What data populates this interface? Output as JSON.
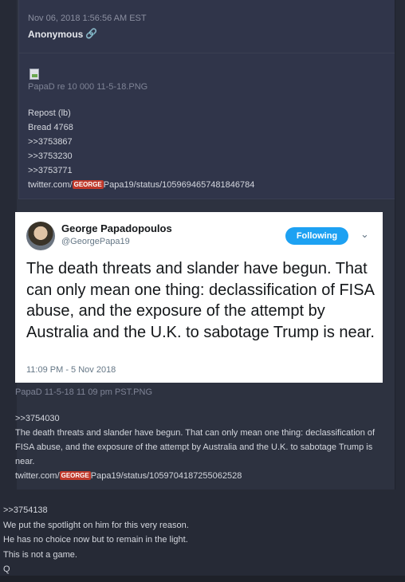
{
  "post": {
    "timestamp": "Nov 06, 2018 1:56:56 AM EST",
    "author": "Anonymous",
    "image_filename": "PapaD re 10 000 11-5-18.PNG",
    "lines": [
      "Repost (lb)",
      "Bread 4768",
      ">>3753867",
      ">>3753230",
      ">>3753771"
    ],
    "link_prefix": "twitter.com/",
    "link_tag": "GEORGE",
    "link_suffix": "Papa19/status/1059694657481846784"
  },
  "tweet": {
    "name": "George Papadopoulos",
    "handle": "@GeorgePapa19",
    "follow_label": "Following",
    "text": "The death threats and slander have begun. That can only mean one thing: declassification of FISA abuse, and the exposure of the attempt by Australia and the U.K. to sabotage Trump is near.",
    "time": "11:09 PM - 5 Nov 2018"
  },
  "post2": {
    "image_filename": "PapaD 11-5-18 11 09 pm PST.PNG",
    "ref": ">>3754030",
    "body": "The death threats and slander have begun. That can only mean one thing: declassification of FISA abuse, and the exposure of the attempt by Australia and the U.K. to sabotage Trump is near.",
    "link_prefix": "twitter.com/",
    "link_tag": "GEORGE",
    "link_suffix": "Papa19/status/1059704187255062528"
  },
  "reply": {
    "ref": ">>3754138",
    "lines": [
      "We put the spotlight on him for this very reason.",
      "He has no choice now but to remain in the light.",
      "This is not a game.",
      "Q"
    ]
  }
}
